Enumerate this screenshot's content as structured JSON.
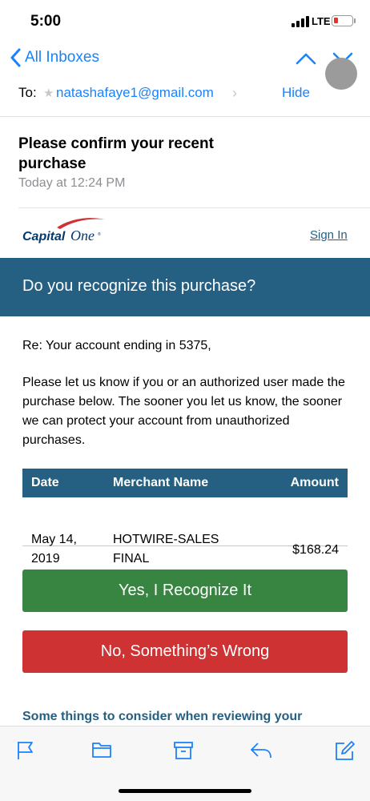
{
  "status": {
    "time": "5:00",
    "network": "LTE"
  },
  "nav": {
    "back_label": "All Inboxes"
  },
  "header": {
    "to_label": "To:",
    "recipient": "natashafaye1@gmail.com",
    "hide_label": "Hide",
    "subject": "Please confirm your recent purchase",
    "timestamp": "Today at 12:24 PM"
  },
  "email": {
    "logo_text": "Capital One",
    "signin_label": "Sign In",
    "banner": "Do you recognize this purchase?",
    "account_line": "Re: Your account ending in 5375,",
    "paragraph": "Please let us know if you or an authorized user made the purchase below. The sooner you let us know, the sooner we can protect your account from unauthorized purchases.",
    "table": {
      "headers": [
        "Date",
        "Merchant Name",
        "Amount"
      ],
      "rows": [
        {
          "date_line1": "May 14,",
          "date_line2": "2019",
          "merchant_line1": "HOTWIRE-SALES",
          "merchant_line2": "FINAL",
          "amount": "$168.24"
        }
      ]
    },
    "yes_button": "Yes, I Recognize It",
    "no_button": "No, Something’s Wrong",
    "consider_text": "Some things to consider when reviewing your"
  },
  "colors": {
    "ios_blue": "#1a82fb",
    "brand_blue": "#255f82",
    "green": "#378540",
    "red": "#cf3233"
  },
  "toolbar": {
    "icons": [
      "flag-icon",
      "folder-icon",
      "archive-icon",
      "reply-icon",
      "compose-icon"
    ]
  }
}
